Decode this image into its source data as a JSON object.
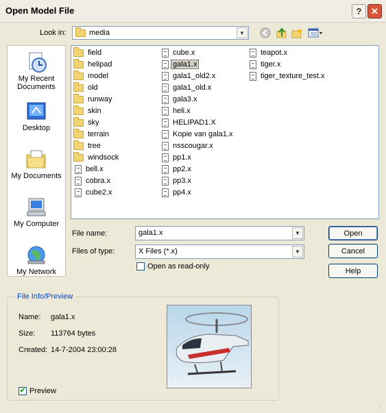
{
  "window": {
    "title": "Open Model File"
  },
  "lookin": {
    "label": "Look in:",
    "value": "media"
  },
  "places": [
    {
      "name": "my-recent-documents",
      "label": "My Recent Documents",
      "icon": "recent-documents-icon"
    },
    {
      "name": "desktop",
      "label": "Desktop",
      "icon": "desktop-icon"
    },
    {
      "name": "my-documents",
      "label": "My Documents",
      "icon": "my-documents-icon"
    },
    {
      "name": "my-computer",
      "label": "My Computer",
      "icon": "my-computer-icon"
    },
    {
      "name": "my-network",
      "label": "My Network",
      "icon": "my-network-icon"
    }
  ],
  "files": {
    "col1": [
      {
        "name": "field",
        "type": "folder"
      },
      {
        "name": "helipad",
        "type": "folder"
      },
      {
        "name": "model",
        "type": "folder"
      },
      {
        "name": "old",
        "type": "folder"
      },
      {
        "name": "runway",
        "type": "folder"
      },
      {
        "name": "skin",
        "type": "folder"
      },
      {
        "name": "sky",
        "type": "folder"
      },
      {
        "name": "terrain",
        "type": "folder"
      },
      {
        "name": "tree",
        "type": "folder"
      },
      {
        "name": "windsock",
        "type": "folder"
      },
      {
        "name": "bell.x",
        "type": "file"
      },
      {
        "name": "cobra.x",
        "type": "file"
      },
      {
        "name": "cube2.x",
        "type": "file"
      }
    ],
    "col2": [
      {
        "name": "cube.x",
        "type": "file"
      },
      {
        "name": "gala1.x",
        "type": "file",
        "selected": true
      },
      {
        "name": "gala1_old2.x",
        "type": "file"
      },
      {
        "name": "gala1_old.x",
        "type": "file"
      },
      {
        "name": "gala3.x",
        "type": "file"
      },
      {
        "name": "heli.x",
        "type": "file"
      },
      {
        "name": "HELIPAD1.X",
        "type": "file"
      },
      {
        "name": "Kopie van gala1.x",
        "type": "file"
      },
      {
        "name": "nsscougar.x",
        "type": "file"
      },
      {
        "name": "pp1.x",
        "type": "file"
      },
      {
        "name": "pp2.x",
        "type": "file"
      },
      {
        "name": "pp3.x",
        "type": "file"
      },
      {
        "name": "pp4.x",
        "type": "file"
      }
    ],
    "col3": [
      {
        "name": "teapot.x",
        "type": "file"
      },
      {
        "name": "tiger.x",
        "type": "file"
      },
      {
        "name": "tiger_texture_test.x",
        "type": "file"
      }
    ]
  },
  "filename": {
    "label": "File name:",
    "value": "gala1.x"
  },
  "filetype": {
    "label": "Files of type:",
    "value": "X Files (*.x)"
  },
  "readonly": {
    "label": "Open as read-only",
    "checked": false
  },
  "buttons": {
    "open": "Open",
    "cancel": "Cancel",
    "help": "Help"
  },
  "info": {
    "title": "File Info/Preview",
    "name_label": "Name:",
    "name_value": "gala1.x",
    "size_label": "Size:",
    "size_value": "113764 bytes",
    "created_label": "Created:",
    "created_value": "14-7-2004 23:00:28",
    "preview_label": "Preview",
    "preview_checked": true,
    "check_mark": "✔"
  }
}
